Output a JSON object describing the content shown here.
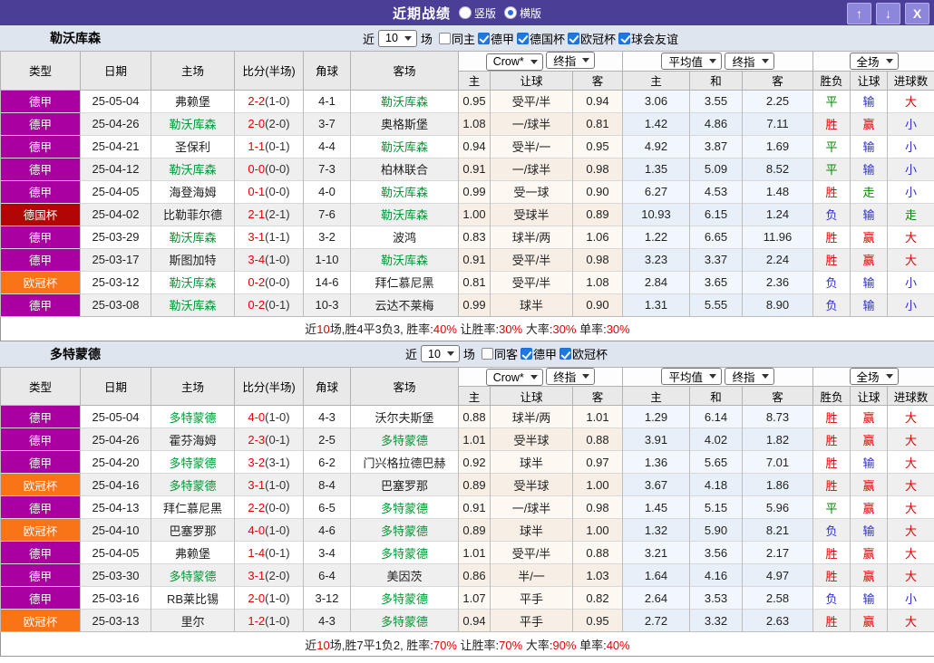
{
  "header": {
    "title": "近期战绩",
    "radios": [
      {
        "label": "竖版",
        "checked": false
      },
      {
        "label": "横版",
        "checked": true
      }
    ],
    "buttons": [
      {
        "name": "up",
        "glyph": "↑"
      },
      {
        "name": "down",
        "glyph": "↓"
      },
      {
        "name": "close",
        "glyph": "X"
      }
    ]
  },
  "colors": {
    "titlebar": "#4a3e96",
    "comp": {
      "德甲": "#aa00a2",
      "德国杯": "#b20505",
      "欧冠杯": "#f97417"
    },
    "result": {
      "胜": "#e60000",
      "赢": "#e60000",
      "大": "#e60000",
      "平": "#008800",
      "走": "#008800",
      "负": "#2f2fd3",
      "输": "#2f2fd3",
      "小": "#2f2fd3"
    },
    "focus_team": "#009933",
    "score_red": "#e60000"
  },
  "table_head": {
    "cols": [
      "类型",
      "日期",
      "主场",
      "比分(半场)",
      "角球",
      "客场"
    ],
    "group1": {
      "selects": [
        "Crow*",
        "终指"
      ],
      "subcols": [
        "主",
        "让球",
        "客"
      ]
    },
    "group2": {
      "selects": [
        "平均值",
        "终指"
      ],
      "subcols": [
        "主",
        "和",
        "客"
      ]
    },
    "group3": {
      "selects": [
        "全场"
      ],
      "subcols": [
        "胜负",
        "让球",
        "进球数"
      ]
    }
  },
  "tables": [
    {
      "team": "勒沃库森",
      "filter": {
        "prefix": "近",
        "count": "10",
        "suffix": "场",
        "checkboxes": [
          {
            "label": "同主",
            "checked": false
          },
          {
            "label": "德甲",
            "checked": true
          },
          {
            "label": "德国杯",
            "checked": true
          },
          {
            "label": "欧冠杯",
            "checked": true
          },
          {
            "label": "球会友谊",
            "checked": true
          }
        ]
      },
      "rows": [
        {
          "comp": "德甲",
          "date": "25-05-04",
          "home": "弗赖堡",
          "home_focus": false,
          "score": "2-2",
          "half": "(1-0)",
          "corner": "4-1",
          "away": "勒沃库森",
          "away_focus": true,
          "crow": [
            "0.95",
            "受平/半",
            "0.94"
          ],
          "avg": [
            "3.06",
            "3.55",
            "2.25"
          ],
          "res": [
            "平",
            "输",
            "大"
          ]
        },
        {
          "comp": "德甲",
          "date": "25-04-26",
          "home": "勒沃库森",
          "home_focus": true,
          "score": "2-0",
          "half": "(2-0)",
          "corner": "3-7",
          "away": "奥格斯堡",
          "away_focus": false,
          "crow": [
            "1.08",
            "一/球半",
            "0.81"
          ],
          "avg": [
            "1.42",
            "4.86",
            "7.11"
          ],
          "res": [
            "胜",
            "赢",
            "小"
          ]
        },
        {
          "comp": "德甲",
          "date": "25-04-21",
          "home": "圣保利",
          "home_focus": false,
          "score": "1-1",
          "half": "(0-1)",
          "corner": "4-4",
          "away": "勒沃库森",
          "away_focus": true,
          "crow": [
            "0.94",
            "受半/一",
            "0.95"
          ],
          "avg": [
            "4.92",
            "3.87",
            "1.69"
          ],
          "res": [
            "平",
            "输",
            "小"
          ]
        },
        {
          "comp": "德甲",
          "date": "25-04-12",
          "home": "勒沃库森",
          "home_focus": true,
          "score": "0-0",
          "half": "(0-0)",
          "corner": "7-3",
          "away": "柏林联合",
          "away_focus": false,
          "crow": [
            "0.91",
            "一/球半",
            "0.98"
          ],
          "avg": [
            "1.35",
            "5.09",
            "8.52"
          ],
          "res": [
            "平",
            "输",
            "小"
          ]
        },
        {
          "comp": "德甲",
          "date": "25-04-05",
          "home": "海登海姆",
          "home_focus": false,
          "score": "0-1",
          "half": "(0-0)",
          "corner": "4-0",
          "away": "勒沃库森",
          "away_focus": true,
          "crow": [
            "0.99",
            "受一球",
            "0.90"
          ],
          "avg": [
            "6.27",
            "4.53",
            "1.48"
          ],
          "res": [
            "胜",
            "走",
            "小"
          ]
        },
        {
          "comp": "德国杯",
          "date": "25-04-02",
          "home": "比勒菲尔德",
          "home_focus": false,
          "score": "2-1",
          "half": "(2-1)",
          "corner": "7-6",
          "away": "勒沃库森",
          "away_focus": true,
          "crow": [
            "1.00",
            "受球半",
            "0.89"
          ],
          "avg": [
            "10.93",
            "6.15",
            "1.24"
          ],
          "res": [
            "负",
            "输",
            "走"
          ]
        },
        {
          "comp": "德甲",
          "date": "25-03-29",
          "home": "勒沃库森",
          "home_focus": true,
          "score": "3-1",
          "half": "(1-1)",
          "corner": "3-2",
          "away": "波鸿",
          "away_focus": false,
          "crow": [
            "0.83",
            "球半/两",
            "1.06"
          ],
          "avg": [
            "1.22",
            "6.65",
            "11.96"
          ],
          "res": [
            "胜",
            "赢",
            "大"
          ]
        },
        {
          "comp": "德甲",
          "date": "25-03-17",
          "home": "斯图加特",
          "home_focus": false,
          "score": "3-4",
          "half": "(1-0)",
          "corner": "1-10",
          "away": "勒沃库森",
          "away_focus": true,
          "crow": [
            "0.91",
            "受平/半",
            "0.98"
          ],
          "avg": [
            "3.23",
            "3.37",
            "2.24"
          ],
          "res": [
            "胜",
            "赢",
            "大"
          ]
        },
        {
          "comp": "欧冠杯",
          "date": "25-03-12",
          "home": "勒沃库森",
          "home_focus": true,
          "score": "0-2",
          "half": "(0-0)",
          "corner": "14-6",
          "away": "拜仁慕尼黑",
          "away_focus": false,
          "crow": [
            "0.81",
            "受平/半",
            "1.08"
          ],
          "avg": [
            "2.84",
            "3.65",
            "2.36"
          ],
          "res": [
            "负",
            "输",
            "小"
          ]
        },
        {
          "comp": "德甲",
          "date": "25-03-08",
          "home": "勒沃库森",
          "home_focus": true,
          "score": "0-2",
          "half": "(0-1)",
          "corner": "10-3",
          "away": "云达不莱梅",
          "away_focus": false,
          "crow": [
            "0.99",
            "球半",
            "0.90"
          ],
          "avg": [
            "1.31",
            "5.55",
            "8.90"
          ],
          "res": [
            "负",
            "输",
            "小"
          ]
        }
      ],
      "summary": [
        {
          "t": "近"
        },
        {
          "t": "10",
          "red": true
        },
        {
          "t": "场,胜4平3负3, 胜率:"
        },
        {
          "t": "40%",
          "red": true
        },
        {
          "t": " 让胜率:"
        },
        {
          "t": "30%",
          "red": true
        },
        {
          "t": " 大率:"
        },
        {
          "t": "30%",
          "red": true
        },
        {
          "t": " 单率:"
        },
        {
          "t": "30%",
          "red": true
        }
      ]
    },
    {
      "team": "多特蒙德",
      "filter": {
        "prefix": "近",
        "count": "10",
        "suffix": "场",
        "checkboxes": [
          {
            "label": "同客",
            "checked": false
          },
          {
            "label": "德甲",
            "checked": true
          },
          {
            "label": "欧冠杯",
            "checked": true
          }
        ]
      },
      "rows": [
        {
          "comp": "德甲",
          "date": "25-05-04",
          "home": "多特蒙德",
          "home_focus": true,
          "score": "4-0",
          "half": "(1-0)",
          "corner": "4-3",
          "away": "沃尔夫斯堡",
          "away_focus": false,
          "crow": [
            "0.88",
            "球半/两",
            "1.01"
          ],
          "avg": [
            "1.29",
            "6.14",
            "8.73"
          ],
          "res": [
            "胜",
            "赢",
            "大"
          ]
        },
        {
          "comp": "德甲",
          "date": "25-04-26",
          "home": "霍芬海姆",
          "home_focus": false,
          "score": "2-3",
          "half": "(0-1)",
          "corner": "2-5",
          "away": "多特蒙德",
          "away_focus": true,
          "crow": [
            "1.01",
            "受半球",
            "0.88"
          ],
          "avg": [
            "3.91",
            "4.02",
            "1.82"
          ],
          "res": [
            "胜",
            "赢",
            "大"
          ]
        },
        {
          "comp": "德甲",
          "date": "25-04-20",
          "home": "多特蒙德",
          "home_focus": true,
          "score": "3-2",
          "half": "(3-1)",
          "corner": "6-2",
          "away": "门兴格拉德巴赫",
          "away_focus": false,
          "crow": [
            "0.92",
            "球半",
            "0.97"
          ],
          "avg": [
            "1.36",
            "5.65",
            "7.01"
          ],
          "res": [
            "胜",
            "输",
            "大"
          ]
        },
        {
          "comp": "欧冠杯",
          "date": "25-04-16",
          "home": "多特蒙德",
          "home_focus": true,
          "score": "3-1",
          "half": "(1-0)",
          "corner": "8-4",
          "away": "巴塞罗那",
          "away_focus": false,
          "crow": [
            "0.89",
            "受半球",
            "1.00"
          ],
          "avg": [
            "3.67",
            "4.18",
            "1.86"
          ],
          "res": [
            "胜",
            "赢",
            "大"
          ]
        },
        {
          "comp": "德甲",
          "date": "25-04-13",
          "home": "拜仁慕尼黑",
          "home_focus": false,
          "score": "2-2",
          "half": "(0-0)",
          "corner": "6-5",
          "away": "多特蒙德",
          "away_focus": true,
          "crow": [
            "0.91",
            "一/球半",
            "0.98"
          ],
          "avg": [
            "1.45",
            "5.15",
            "5.96"
          ],
          "res": [
            "平",
            "赢",
            "大"
          ]
        },
        {
          "comp": "欧冠杯",
          "date": "25-04-10",
          "home": "巴塞罗那",
          "home_focus": false,
          "score": "4-0",
          "half": "(1-0)",
          "corner": "4-6",
          "away": "多特蒙德",
          "away_focus": true,
          "crow": [
            "0.89",
            "球半",
            "1.00"
          ],
          "avg": [
            "1.32",
            "5.90",
            "8.21"
          ],
          "res": [
            "负",
            "输",
            "大"
          ]
        },
        {
          "comp": "德甲",
          "date": "25-04-05",
          "home": "弗赖堡",
          "home_focus": false,
          "score": "1-4",
          "half": "(0-1)",
          "corner": "3-4",
          "away": "多特蒙德",
          "away_focus": true,
          "crow": [
            "1.01",
            "受平/半",
            "0.88"
          ],
          "avg": [
            "3.21",
            "3.56",
            "2.17"
          ],
          "res": [
            "胜",
            "赢",
            "大"
          ]
        },
        {
          "comp": "德甲",
          "date": "25-03-30",
          "home": "多特蒙德",
          "home_focus": true,
          "score": "3-1",
          "half": "(2-0)",
          "corner": "6-4",
          "away": "美因茨",
          "away_focus": false,
          "crow": [
            "0.86",
            "半/一",
            "1.03"
          ],
          "avg": [
            "1.64",
            "4.16",
            "4.97"
          ],
          "res": [
            "胜",
            "赢",
            "大"
          ]
        },
        {
          "comp": "德甲",
          "date": "25-03-16",
          "home": "RB莱比锡",
          "home_focus": false,
          "score": "2-0",
          "half": "(1-0)",
          "corner": "3-12",
          "away": "多特蒙德",
          "away_focus": true,
          "crow": [
            "1.07",
            "平手",
            "0.82"
          ],
          "avg": [
            "2.64",
            "3.53",
            "2.58"
          ],
          "res": [
            "负",
            "输",
            "小"
          ]
        },
        {
          "comp": "欧冠杯",
          "date": "25-03-13",
          "home": "里尔",
          "home_focus": false,
          "score": "1-2",
          "half": "(1-0)",
          "corner": "4-3",
          "away": "多特蒙德",
          "away_focus": true,
          "crow": [
            "0.94",
            "平手",
            "0.95"
          ],
          "avg": [
            "2.72",
            "3.32",
            "2.63"
          ],
          "res": [
            "胜",
            "赢",
            "大"
          ]
        }
      ],
      "summary": [
        {
          "t": "近"
        },
        {
          "t": "10",
          "red": true
        },
        {
          "t": "场,胜7平1负2, 胜率:"
        },
        {
          "t": "70%",
          "red": true
        },
        {
          "t": " 让胜率:"
        },
        {
          "t": "70%",
          "red": true
        },
        {
          "t": " 大率:"
        },
        {
          "t": "90%",
          "red": true
        },
        {
          "t": " 单率:"
        },
        {
          "t": "40%",
          "red": true
        }
      ]
    }
  ]
}
